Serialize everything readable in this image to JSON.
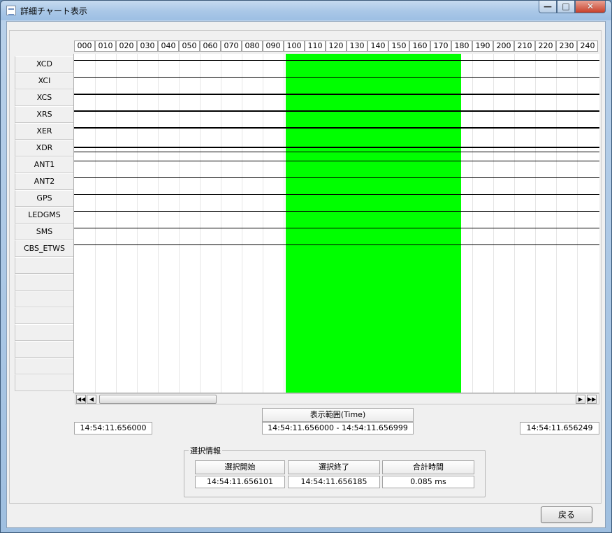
{
  "window": {
    "title": "詳細チャート表示"
  },
  "caption": {
    "minimize": "—",
    "maximize": "□",
    "close": "✕"
  },
  "timeline": {
    "ticks": [
      "000",
      "010",
      "020",
      "030",
      "040",
      "050",
      "060",
      "070",
      "080",
      "090",
      "100",
      "110",
      "120",
      "130",
      "140",
      "150",
      "160",
      "170",
      "180",
      "190",
      "200",
      "210",
      "220",
      "230",
      "240"
    ],
    "selection_start_tick": 100,
    "selection_end_tick": 184.5
  },
  "signals": [
    "XCD",
    "XCI",
    "XCS",
    "XRS",
    "XER",
    "XDR",
    "ANT1",
    "ANT2",
    "GPS",
    "LEDGMS",
    "SMS",
    "CBS_ETWS",
    "",
    "",
    "",
    "",
    "",
    "",
    "",
    ""
  ],
  "range": {
    "header": "表示範囲(Time)",
    "left_time": "14:54:11.656000",
    "range_text": "14:54:11.656000 - 14:54:11.656999",
    "right_time": "14:54:11.656249"
  },
  "selection": {
    "group_label": "選択情報",
    "start_header": "選択開始",
    "end_header": "選択終了",
    "total_header": "合計時間",
    "start_value": "14:54:11.656101",
    "end_value": "14:54:11.656185",
    "total_value": "0.085 ms"
  },
  "buttons": {
    "back": "戻る"
  },
  "colors": {
    "selection": "#00ff00"
  }
}
